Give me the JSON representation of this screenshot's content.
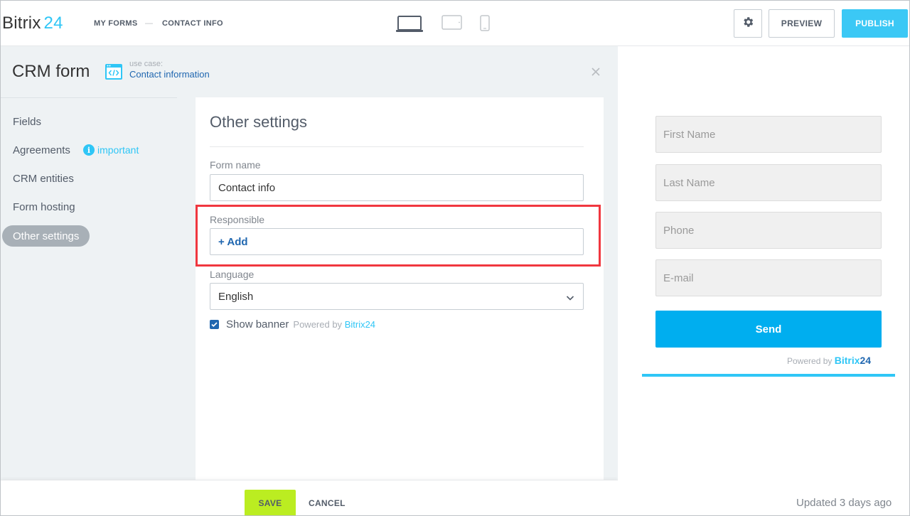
{
  "header": {
    "logo_text": "Bitrix",
    "logo_number": "24",
    "breadcrumb": [
      "MY FORMS",
      "CONTACT INFO"
    ],
    "breadcrumb_separator": "—",
    "devices": [
      "laptop-icon",
      "tablet-icon",
      "phone-icon"
    ],
    "settings_icon": "gear-icon",
    "preview_label": "PREVIEW",
    "publish_label": "PUBLISH"
  },
  "panel": {
    "title": "CRM form",
    "use_case_label": "use case:",
    "use_case_link": "Contact information",
    "use_case_icon": "code-window-icon",
    "close_icon": "close-icon"
  },
  "nav": {
    "items": [
      {
        "label": "Fields",
        "active": false
      },
      {
        "label": "Agreements",
        "active": false
      },
      {
        "label": "CRM entities",
        "active": false
      },
      {
        "label": "Form hosting",
        "active": false
      },
      {
        "label": "Other settings",
        "active": true
      }
    ],
    "important_label": "important",
    "important_icon": "info-icon"
  },
  "settings": {
    "title": "Other settings",
    "form_name_label": "Form name",
    "form_name_value": "Contact info",
    "responsible_label": "Responsible",
    "add_label": "+ Add",
    "language_label": "Language",
    "language_value": "English",
    "show_banner_label": "Show banner",
    "show_banner_checked": true,
    "powered_by_prefix": "Powered by",
    "powered_by_brand": "Bitrix24"
  },
  "footer": {
    "save_label": "SAVE",
    "cancel_label": "CANCEL"
  },
  "preview": {
    "fields": [
      "First Name",
      "Last Name",
      "Phone",
      "E-mail"
    ],
    "send_label": "Send",
    "powered_prefix": "Powered by",
    "powered_brand": "Bitrix",
    "powered_brand_number": "24",
    "updated_text": "Updated 3 days ago"
  },
  "colors": {
    "accent": "#2fc6f6",
    "publish": "#3bc8f5",
    "save": "#bbed21",
    "send": "#00aeef",
    "highlight_border": "#f0373f",
    "link": "#2067b0"
  }
}
